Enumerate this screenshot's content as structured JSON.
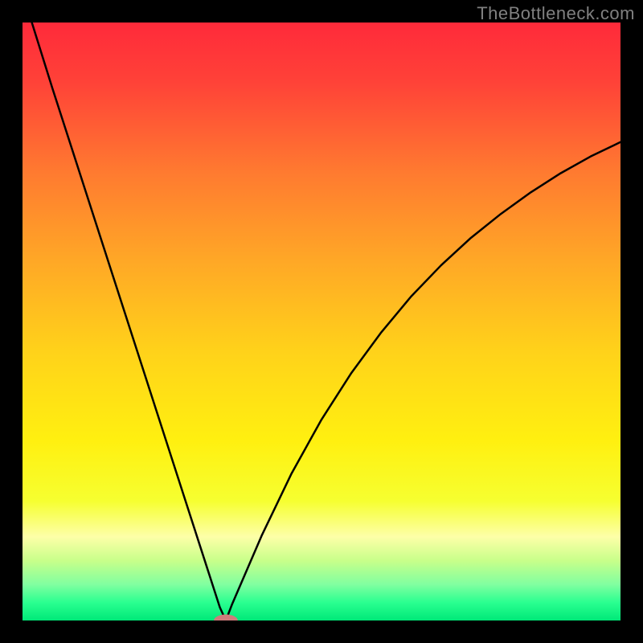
{
  "watermark": "TheBottleneck.com",
  "chart_data": {
    "type": "line",
    "title": "",
    "xlabel": "",
    "ylabel": "",
    "xlim": [
      0,
      100
    ],
    "ylim": [
      0,
      100
    ],
    "series": [
      {
        "name": "curve",
        "x": [
          0,
          5,
          10,
          15,
          20,
          25,
          30,
          33,
          34,
          35,
          40,
          45,
          50,
          55,
          60,
          65,
          70,
          75,
          80,
          85,
          90,
          95,
          100
        ],
        "y": [
          105,
          89,
          73.5,
          58,
          42.5,
          27,
          11.5,
          2.2,
          0,
          2.6,
          14.2,
          24.6,
          33.6,
          41.4,
          48.2,
          54.2,
          59.4,
          64,
          68,
          71.6,
          74.8,
          77.6,
          80
        ]
      }
    ],
    "marker": {
      "x": 34,
      "y": 0,
      "rx": 2.0,
      "ry": 1.0,
      "color": "#cf7b7b"
    },
    "gradient_stops": [
      {
        "offset": 0.0,
        "color": "#ff2a3a"
      },
      {
        "offset": 0.1,
        "color": "#ff4238"
      },
      {
        "offset": 0.25,
        "color": "#ff7a30"
      },
      {
        "offset": 0.4,
        "color": "#ffa826"
      },
      {
        "offset": 0.55,
        "color": "#ffd21a"
      },
      {
        "offset": 0.7,
        "color": "#fff010"
      },
      {
        "offset": 0.8,
        "color": "#f6ff30"
      },
      {
        "offset": 0.86,
        "color": "#fdffa8"
      },
      {
        "offset": 0.9,
        "color": "#c8ff8a"
      },
      {
        "offset": 0.94,
        "color": "#80ffa0"
      },
      {
        "offset": 0.97,
        "color": "#2aff90"
      },
      {
        "offset": 1.0,
        "color": "#00e878"
      }
    ]
  }
}
